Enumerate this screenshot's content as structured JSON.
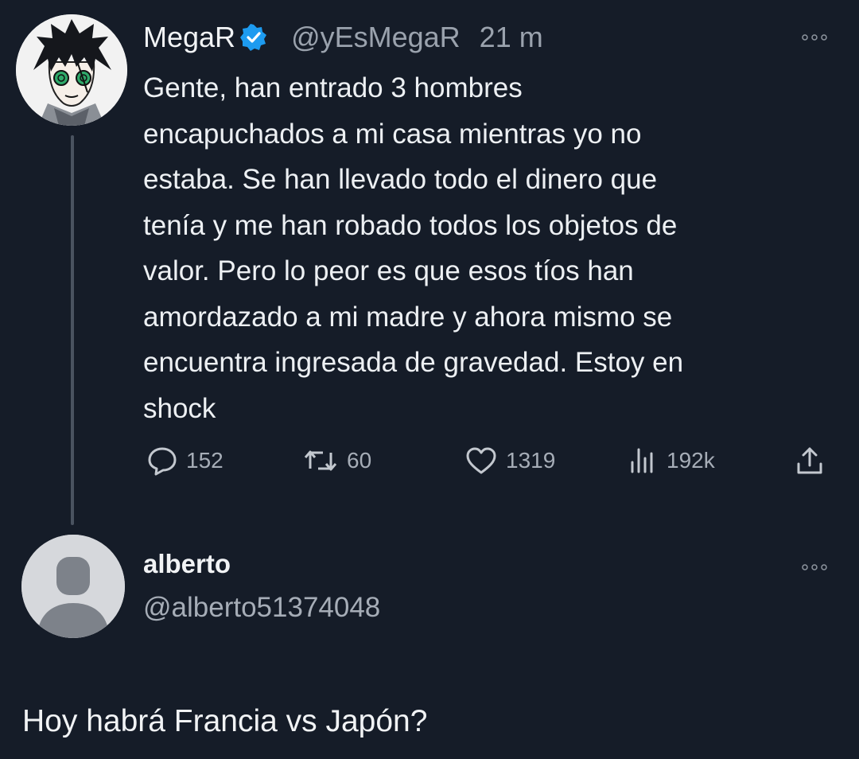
{
  "tweet": {
    "author_name": "MegaR",
    "author_handle": "@yEsMegaR",
    "time": "21 m",
    "text": "Gente, han entrado 3 hombres\nencapuchados a mi casa mientras yo no\nestaba. Se han llevado todo el dinero que\ntenía y me han robado todos los objetos de\nvalor. Pero lo peor es que esos tíos han\namordazado a mi madre y ahora mismo se\nencuentra ingresada de gravedad. Estoy en\nshock",
    "actions": {
      "replies": "152",
      "retweets": "60",
      "likes": "1319",
      "views": "192k"
    },
    "icons": {
      "verified": "verified-badge-icon",
      "more": "more-dots-icon",
      "reply": "reply-bubble-icon",
      "retweet": "retweet-icon",
      "like": "heart-icon",
      "views": "views-bars-icon",
      "share": "share-icon"
    }
  },
  "reply": {
    "author_name": "alberto",
    "author_handle": "@alberto51374048",
    "text": "Hoy habrá Francia vs Japón?"
  },
  "colors": {
    "background": "#151c28",
    "verified": "#1d9bf0",
    "text_primary": "#edf0f3",
    "text_secondary": "#9aa2ad"
  }
}
